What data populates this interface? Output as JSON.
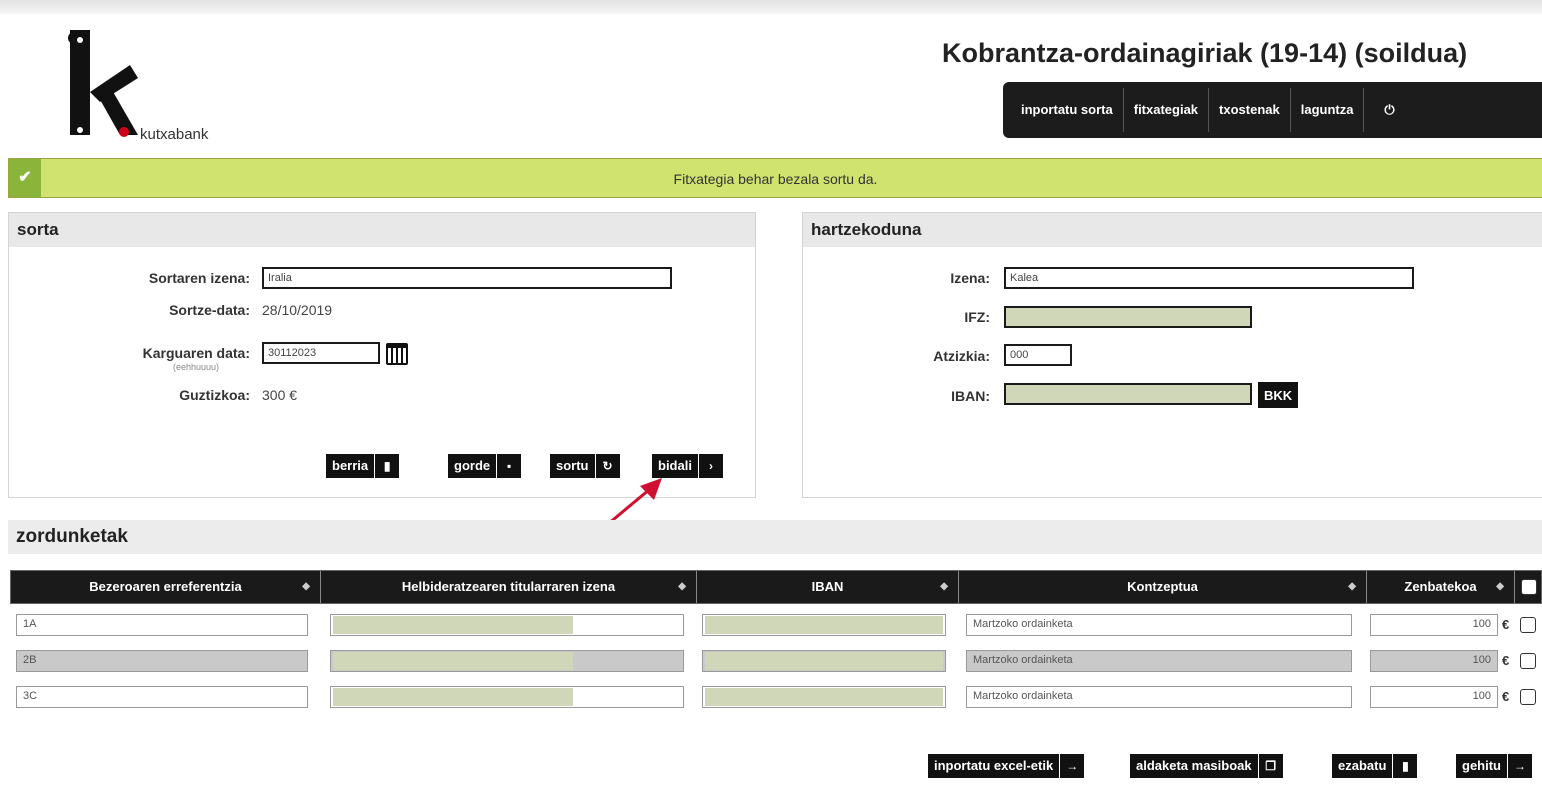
{
  "brand": {
    "name": "kutxabank"
  },
  "header": {
    "title": "Kobrantza-ordainagiriak (19-14) (soildua)"
  },
  "nav": [
    "inportatu sorta",
    "fitxategiak",
    "txostenak",
    "laguntza"
  ],
  "banner": {
    "message": "Fitxategia behar bezala sortu da."
  },
  "sorta": {
    "heading": "sorta",
    "name_label": "Sortaren izena:",
    "name_value": "Iralia",
    "date_label": "Sortze-data:",
    "date_value": "28/10/2019",
    "charge_label": "Karguaren data:",
    "charge_value": "30112023",
    "charge_hint": "(eehhuuuu)",
    "total_label": "Guztizkoa:",
    "total_value": "300 €",
    "buttons": {
      "new": "berria",
      "save": "gorde",
      "create": "sortu",
      "send": "bidali"
    }
  },
  "hartzekoduna": {
    "heading": "hartzekoduna",
    "name_label": "Izena:",
    "name_value": "Kalea",
    "ifz_label": "IFZ:",
    "suffix_label": "Atzizkia:",
    "suffix_value": "000",
    "iban_label": "IBAN:",
    "bkk": "BKK"
  },
  "zordunketak": {
    "heading": "zordunketak",
    "columns": [
      "Bezeroaren erreferentzia",
      "Helbideratzearen titularraren izena",
      "IBAN",
      "Kontzeptua",
      "Zenbatekoa"
    ],
    "rows": [
      {
        "ref": "1A",
        "concept": "Martzoko ordainketa",
        "amount": "100"
      },
      {
        "ref": "2B",
        "concept": "Martzoko ordainketa",
        "amount": "100"
      },
      {
        "ref": "3C",
        "concept": "Martzoko ordainketa",
        "amount": "100"
      }
    ],
    "currency": "€"
  },
  "footer_buttons": {
    "import_excel": "inportatu excel-etik",
    "bulk_edit": "aldaketa masiboak",
    "delete": "ezabatu",
    "add": "gehitu"
  }
}
